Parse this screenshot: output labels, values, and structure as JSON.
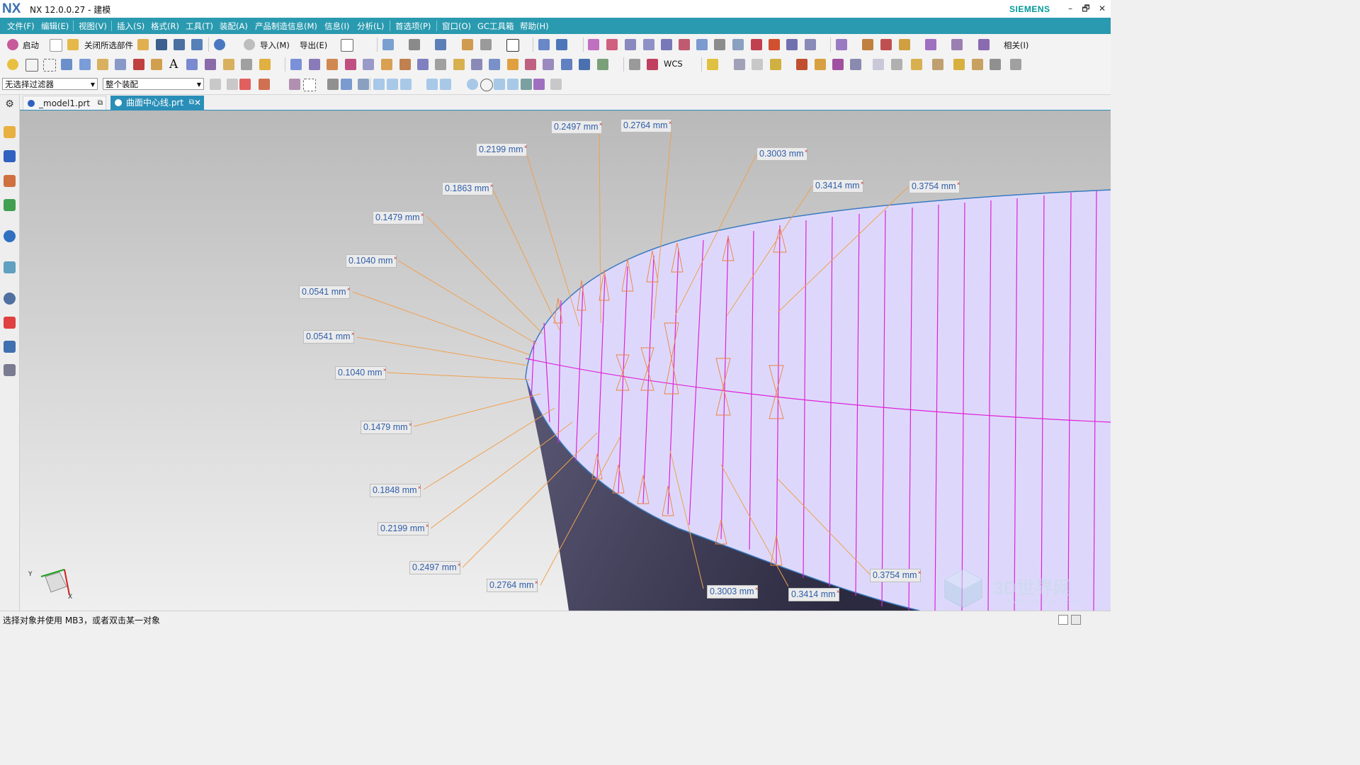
{
  "window": {
    "logo": "NX",
    "title": "NX 12.0.0.27 - 建模",
    "brand": "SIEMENS",
    "controls": [
      "–",
      "🗗",
      "✕"
    ]
  },
  "menubar": {
    "items": [
      "文件(F)",
      "编辑(E)",
      "视图(V)",
      "插入(S)",
      "格式(R)",
      "工具(T)",
      "装配(A)",
      "产品制造信息(M)",
      "信息(I)",
      "分析(L)",
      "首选项(P)",
      "窗口(O)",
      "GC工具箱",
      "帮助(H)"
    ]
  },
  "toolbar": {
    "start_label": "启动",
    "close_selected_label": "关闭所选部件",
    "import_label": "导入(M)",
    "export_label": "导出(E)",
    "wcs_label": "WCS",
    "related_label": "相关(I)",
    "text_tool_glyph": "A"
  },
  "selection_bar": {
    "filter_value": "无选择过滤器",
    "scope_value": "整个装配"
  },
  "tabs": [
    {
      "label": "_model1.prt",
      "active": false
    },
    {
      "label": "曲面中心线.prt",
      "active": true
    }
  ],
  "dimensions": [
    "0.2497 mm",
    "0.2764 mm",
    "0.2199 mm",
    "0.3003 mm",
    "0.1863 mm",
    "0.3414 mm",
    "0.3754 mm",
    "0.1479 mm",
    "0.1040 mm",
    "0.0541 mm",
    "0.0541 mm",
    "0.1040 mm",
    "0.1479 mm",
    "0.1848 mm",
    "0.2199 mm",
    "0.2497 mm",
    "0.2764 mm",
    "0.3003 mm",
    "0.3414 mm",
    "0.3754 mm"
  ],
  "triad": {
    "y_label": "Y",
    "x_label": "X"
  },
  "status": {
    "prompt": "选择对象并使用 MB3，或者双击某一对象"
  },
  "watermark": {
    "text": "3D世界网",
    "url": "www.3dsjw.com"
  },
  "colors": {
    "menubar": "#2a9ab0",
    "surface": "#ddd8fb",
    "isoline": "#e020d8",
    "leader": "#f0a050",
    "dim_text": "#2f5da8",
    "brand": "#009999"
  }
}
